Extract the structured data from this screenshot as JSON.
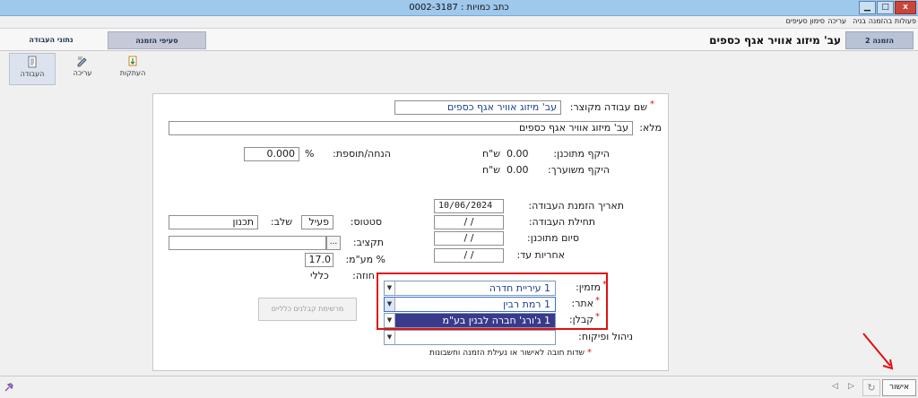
{
  "window": {
    "title": "כתב כמויות : 0002-3187"
  },
  "menu": [
    "פעולות בהזמנה",
    "בניה",
    "עריכה",
    "סימון סעיפים"
  ],
  "tabs": {
    "order2": "הזמנה 2",
    "work_title": "עב' מיזוג אוויר אגף כספים",
    "order_items": "סעיפי הזמנה",
    "work_data": "נתוני העבודה"
  },
  "ribbon": {
    "copies": "העתקות",
    "edit": "עריכה",
    "work": "העבודה"
  },
  "form": {
    "short_name_label": "שם עבודה מקוצר:",
    "short_name_value": "עב' מיזוג אוויר אגף כספים",
    "full_label": "מלא:",
    "full_value": "עב' מיזוג אוויר אגף כספים",
    "planned_label": "היקף מתוכנן:",
    "planned_value": "0.00",
    "planned_unit": "ש\"ח",
    "estimated_label": "היקף משוערך:",
    "estimated_value": "0.00",
    "estimated_unit": "ש\"ח",
    "discount_label": "הנחה/תוספת:",
    "discount_pct": "%",
    "discount_value": "0.000",
    "order_date_label": "תאריך הזמנת העבודה:",
    "order_date_value": "10/06/2024",
    "start_label": "תחילת העבודה:",
    "start_value": "/   /",
    "planned_end_label": "סיום מתוכנן:",
    "planned_end_value": "/   /",
    "warranty_label": "אחריות עד:",
    "warranty_value": "/   /",
    "status_label": "סטטוס:",
    "status_value": "פעיל",
    "stage_label": "שלב:",
    "stage_value": "תכנון",
    "budget_label": "תקציב:",
    "budget_btn": "...",
    "vat_label": "% מע\"מ:",
    "vat_value": "17.0",
    "contract_label": "חוזה:",
    "contract_value": "כללי",
    "orderer_label": "מזמין:",
    "orderer_value": "1  עיריית חדרה",
    "site_label": "אתר:",
    "site_value": "1  רמת רבין",
    "contractor_label": "קבלן:",
    "contractor_value": "1  ג'ורג' חברה לבנין בע\"מ",
    "management_label": "ניהול ופיקוח:",
    "management_value": "",
    "general_contractors_btn": "מרשימת קבלנים כלליים",
    "required_note": "שדות חובה לאישור או נעילת הזמנה וחשבונות"
  },
  "status": {
    "approve": "אישור"
  },
  "colors": {
    "accent_red": "#e01010",
    "titlebar": "#9ec8ec",
    "highlight_select": "#3a3a8c"
  }
}
